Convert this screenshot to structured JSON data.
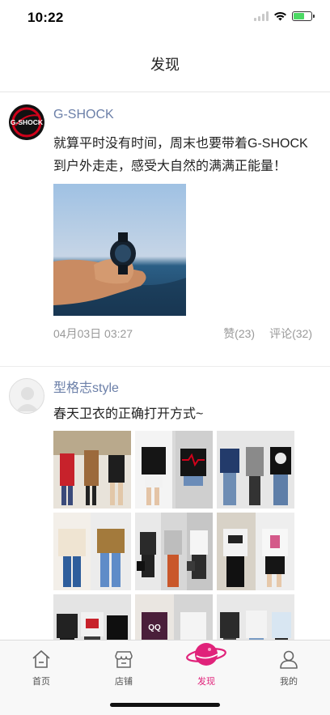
{
  "status_bar": {
    "time": "10:22",
    "battery_level": 0.6,
    "icons": [
      "signal-icon",
      "wifi-icon",
      "battery-charging-icon"
    ]
  },
  "nav": {
    "title": "发现"
  },
  "posts": [
    {
      "author": "G-SHOCK",
      "avatar_logo": "G-SHOCK",
      "text": "就算平时没有时间，周末也要带着G-SHOCK到户外走走，感受大自然的满满正能量！",
      "date": "04月03日  03:27",
      "likes": "赞(23)",
      "comments": "评论(32)",
      "image": "hand-holding-watch-over-sea"
    },
    {
      "author": "型格志style",
      "text": "春天卫衣的正确打开方式~",
      "images": [
        "street-style-1",
        "street-style-2",
        "street-style-3",
        "street-style-4",
        "street-style-5",
        "street-style-6",
        "street-style-7",
        "street-style-8",
        "street-style-9"
      ]
    }
  ],
  "tabs": [
    {
      "label": "首页",
      "icon": "home-icon",
      "active": false
    },
    {
      "label": "店铺",
      "icon": "store-icon",
      "active": false
    },
    {
      "label": "发现",
      "icon": "planet-icon",
      "active": true
    },
    {
      "label": "我的",
      "icon": "user-icon",
      "active": false
    }
  ],
  "colors": {
    "accent": "#e0227a",
    "author": "#6b7fa8",
    "meta": "#9a9a9a"
  }
}
